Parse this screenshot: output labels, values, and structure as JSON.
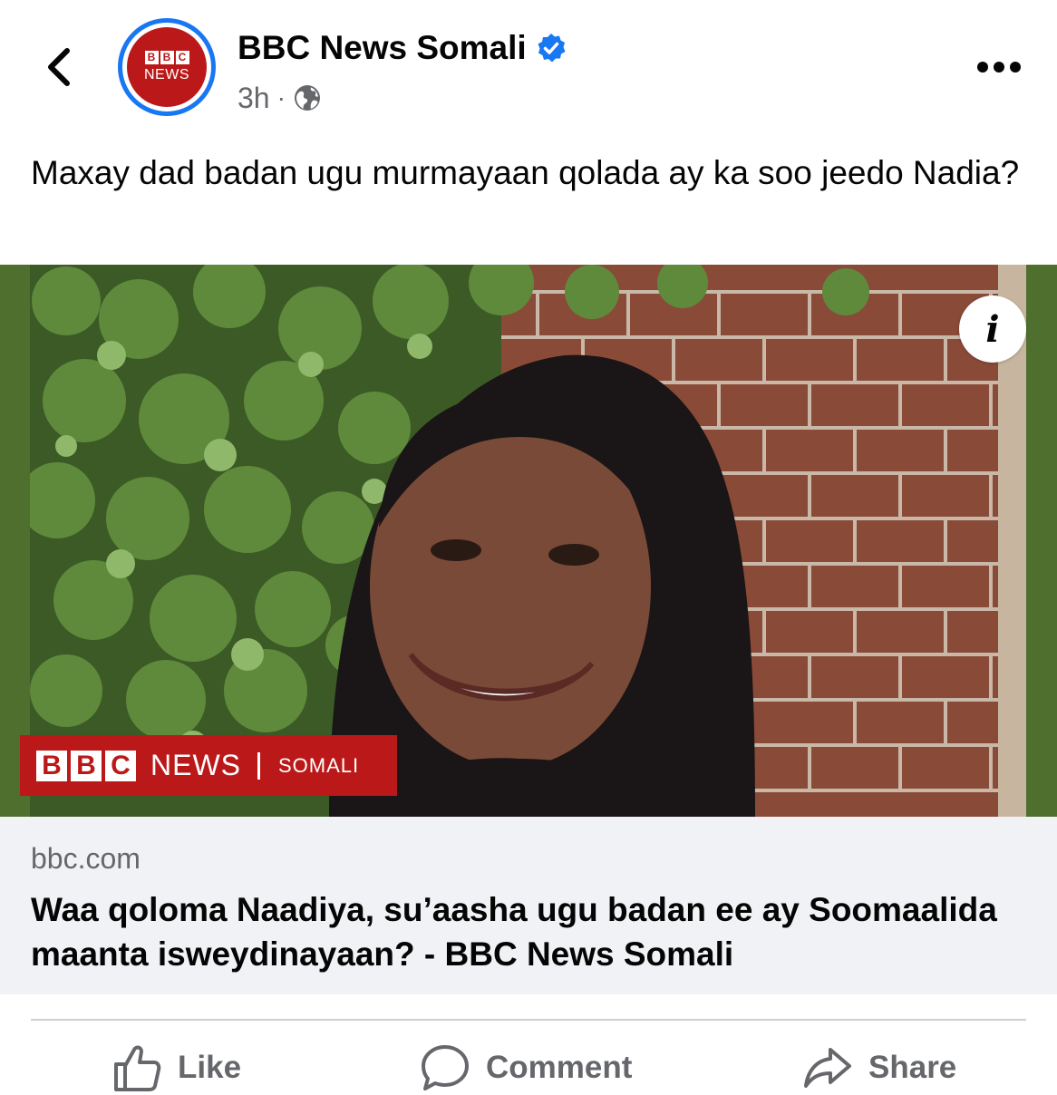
{
  "header": {
    "back_icon": "chevron-left-icon",
    "avatar": {
      "blocks": [
        "B",
        "B",
        "C"
      ],
      "news": "NEWS",
      "brand_color": "#bb1919",
      "ring_color": "#1877f2"
    },
    "page_name": "BBC News Somali",
    "verified_icon": "verified-badge-icon",
    "time": "3h",
    "separator": "·",
    "audience_icon": "globe-icon",
    "more_icon": "more-horizontal-icon"
  },
  "post": {
    "text": "Maxay dad badan ugu murmayaan qolada ay ka soo jeedo Nadia?"
  },
  "photo": {
    "overlay_logo": {
      "blocks": [
        "B",
        "B",
        "C"
      ],
      "news": "NEWS",
      "section": "SOMALI"
    },
    "info_label": "i"
  },
  "link_preview": {
    "domain": "bbc.com",
    "title": "Waa qoloma Naadiya, su’aasha ugu badan ee ay Soomaalida maanta isweydinayaan? - BBC News Somali"
  },
  "actions": {
    "like": "Like",
    "comment": "Comment",
    "share": "Share"
  },
  "colors": {
    "text": "#050505",
    "secondary": "#65676b",
    "link_bg": "#f0f2f5",
    "accent": "#1877f2"
  }
}
